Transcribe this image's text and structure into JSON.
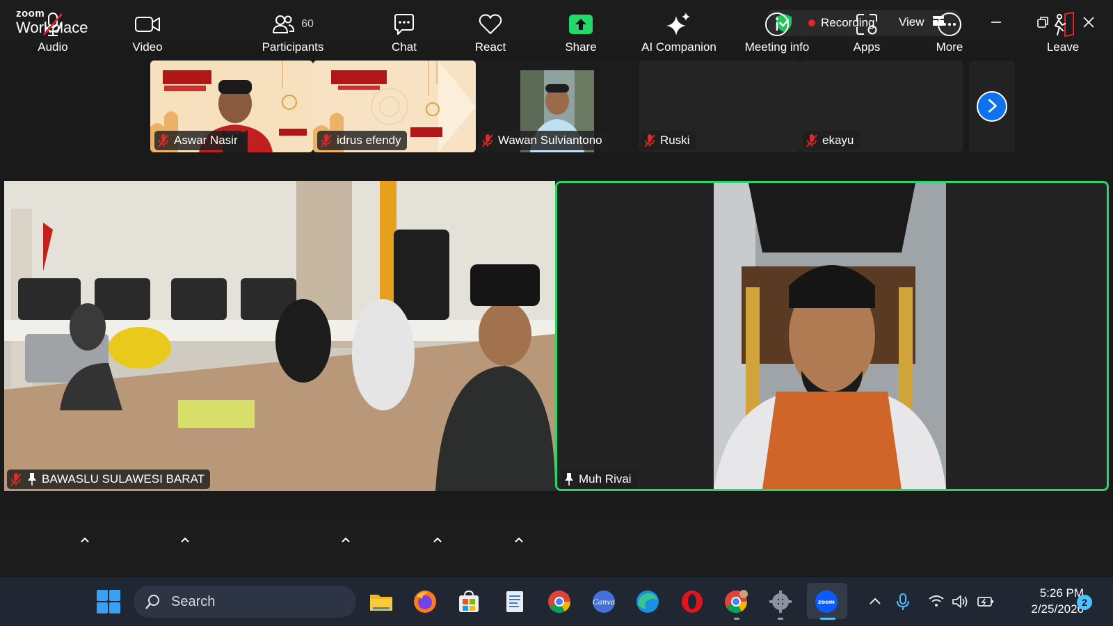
{
  "titlebar": {
    "brand_top": "zoom",
    "brand_bottom": "Workplace",
    "recording_label": "Recording",
    "view_label": "View"
  },
  "strip": {
    "participants": [
      {
        "name": "Aswar Nasir",
        "muted": true,
        "video": true
      },
      {
        "name": "idrus efendy",
        "muted": true,
        "video": true
      },
      {
        "name": "Wawan Sulviantono",
        "muted": true,
        "video": true
      },
      {
        "name": "Ruski",
        "muted": true,
        "video": false
      },
      {
        "name": "ekayu",
        "muted": true,
        "video": false
      }
    ]
  },
  "main": {
    "left_tile": {
      "name": "BAWASLU SULAWESI BARAT",
      "muted": true,
      "pinned": true
    },
    "right_tile": {
      "name": "Muh Rivai",
      "active_speaker": true,
      "pinned": true
    }
  },
  "toolbar": {
    "audio": "Audio",
    "video": "Video",
    "participants": "Participants",
    "participants_count": "60",
    "chat": "Chat",
    "react": "React",
    "share": "Share",
    "ai_companion": "AI Companion",
    "meeting_info": "Meeting info",
    "apps": "Apps",
    "more": "More",
    "leave": "Leave"
  },
  "taskbar": {
    "search_placeholder": "Search",
    "time": "5:26 PM",
    "date": "2/25/2026",
    "notification_count": "2"
  },
  "colors": {
    "active_speaker_border": "#23d96b",
    "share_green": "#23d96b",
    "zoom_blue": "#0e72ed",
    "muted_red": "#e02828"
  }
}
